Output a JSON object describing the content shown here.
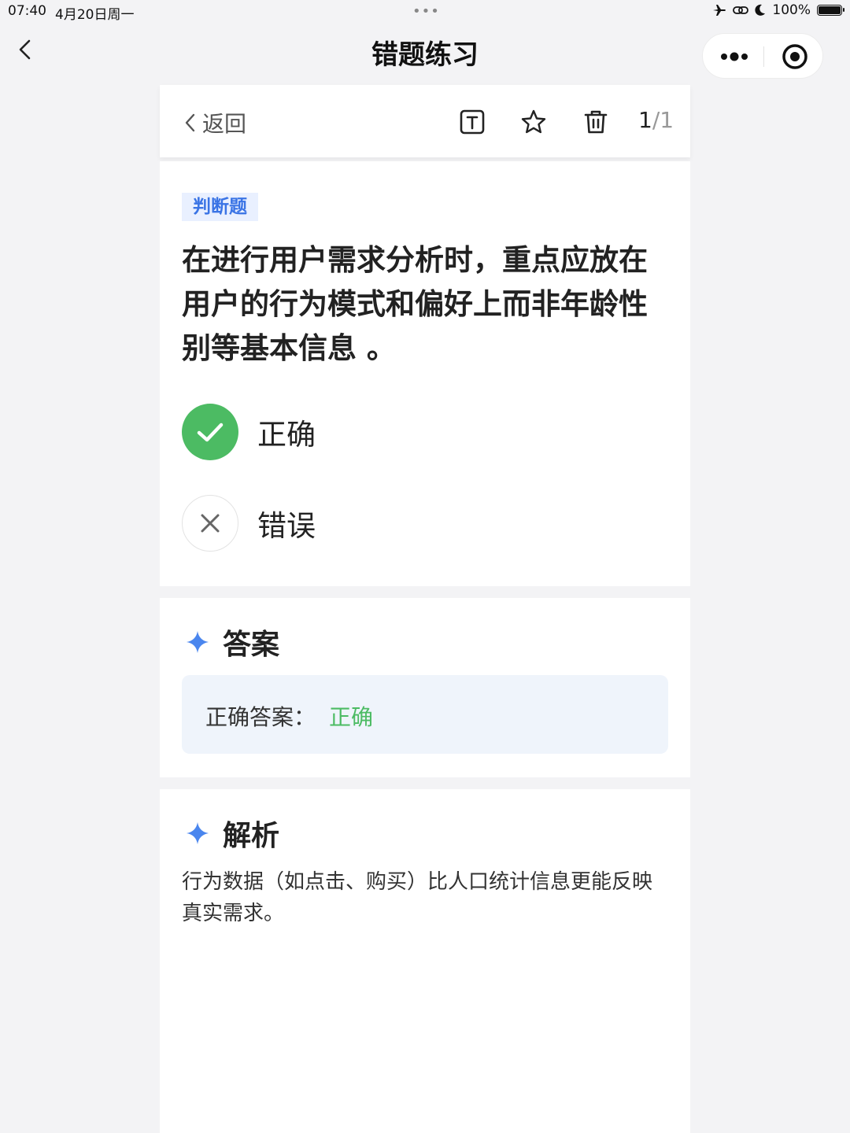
{
  "status_bar": {
    "time": "07:40",
    "date": "4月20日周一",
    "dots": "•••",
    "battery": "100%"
  },
  "nav": {
    "title": "错题练习",
    "more_icon": "more-dots-icon",
    "target_icon": "target-icon"
  },
  "toolbar": {
    "back_label": "返回",
    "icons": [
      "text-size-icon",
      "star-icon",
      "trash-icon"
    ],
    "page_current": "1",
    "page_sep": "/",
    "page_total": "1"
  },
  "question": {
    "type_tag": "判断题",
    "text": "在进行用户需求分析时，重点应放在用户的行为模式和偏好上而非年龄性别等基本信息 。",
    "options": [
      {
        "label": "正确",
        "state": "selected-correct",
        "icon": "check-icon"
      },
      {
        "label": "错误",
        "state": "unselected",
        "icon": "close-icon"
      }
    ]
  },
  "answer": {
    "title": "答案",
    "label": "正确答案：",
    "value": "正确"
  },
  "explanation": {
    "title": "解析",
    "text": "行为数据（如点击、购买）比人口统计信息更能反映真实需求。"
  },
  "colors": {
    "accent_blue": "#3a74e5",
    "correct_green": "#4cbb63",
    "answer_bg": "#eff4fb",
    "page_bg": "#f3f3f5"
  }
}
